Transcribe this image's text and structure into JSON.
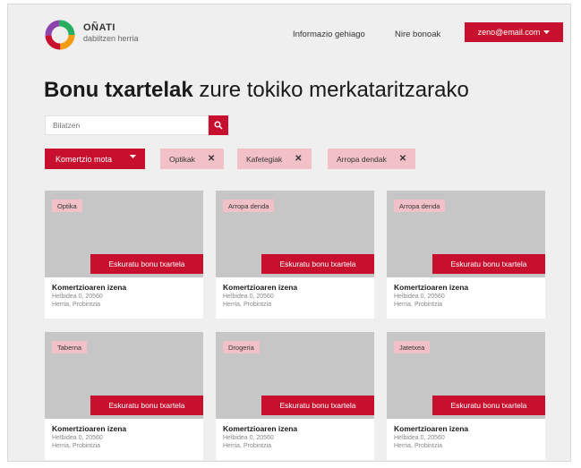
{
  "brand": {
    "name": "OÑATI",
    "tagline": "dabiltzen herria"
  },
  "nav": {
    "info": "Informazio gehiago",
    "my_bonus": "Nire bonoak",
    "email": "zeno@email.com"
  },
  "page_title": {
    "bold": "Bonu txartelak",
    "rest": " zure tokiko merkataritzarako"
  },
  "search": {
    "placeholder": "Bilatzen"
  },
  "filters": {
    "dropdown": "Komertzio mota",
    "chips": [
      "Optikak",
      "Kafetegiak",
      "Arropa dendak"
    ]
  },
  "cards": [
    {
      "badge": "Optika",
      "cta": "Eskuratu bonu txartela",
      "title": "Komertzioaren izena",
      "address": "Helbidea 0, 20560",
      "city": "Herria, Probintzia"
    },
    {
      "badge": "Arropa denda",
      "cta": "Eskuratu bonu txartela",
      "title": "Komertzioaren izena",
      "address": "Helbidea 0, 20560",
      "city": "Herria, Probintzia"
    },
    {
      "badge": "Arropa denda",
      "cta": "Eskuratu bonu txartela",
      "title": "Komertzioaren izena",
      "address": "Helbidea 0, 20560",
      "city": "Herria, Probintzia"
    },
    {
      "badge": "Taberna",
      "cta": "Eskuratu bonu txartela",
      "title": "Komertzioaren izena",
      "address": "Helbidea 0, 20560",
      "city": "Herria, Probintzia"
    },
    {
      "badge": "Drogeria",
      "cta": "Eskuratu bonu txartela",
      "title": "Komertzioaren izena",
      "address": "Helbidea 0, 20560",
      "city": "Herria, Probintzia"
    },
    {
      "badge": "Jatetxea",
      "cta": "Eskuratu bonu txartela",
      "title": "Komertzioaren izena",
      "address": "Helbidea 0, 20560",
      "city": "Herria, Probintzia"
    }
  ],
  "icons": {
    "search": "search-icon",
    "chevron": "chevron-down-icon",
    "close": "close-icon",
    "logo": "ring-logo"
  },
  "colors": {
    "accent": "#c8102e",
    "chip": "#f2c1c8",
    "card_image": "#c6c6c6",
    "background": "#efefef"
  }
}
